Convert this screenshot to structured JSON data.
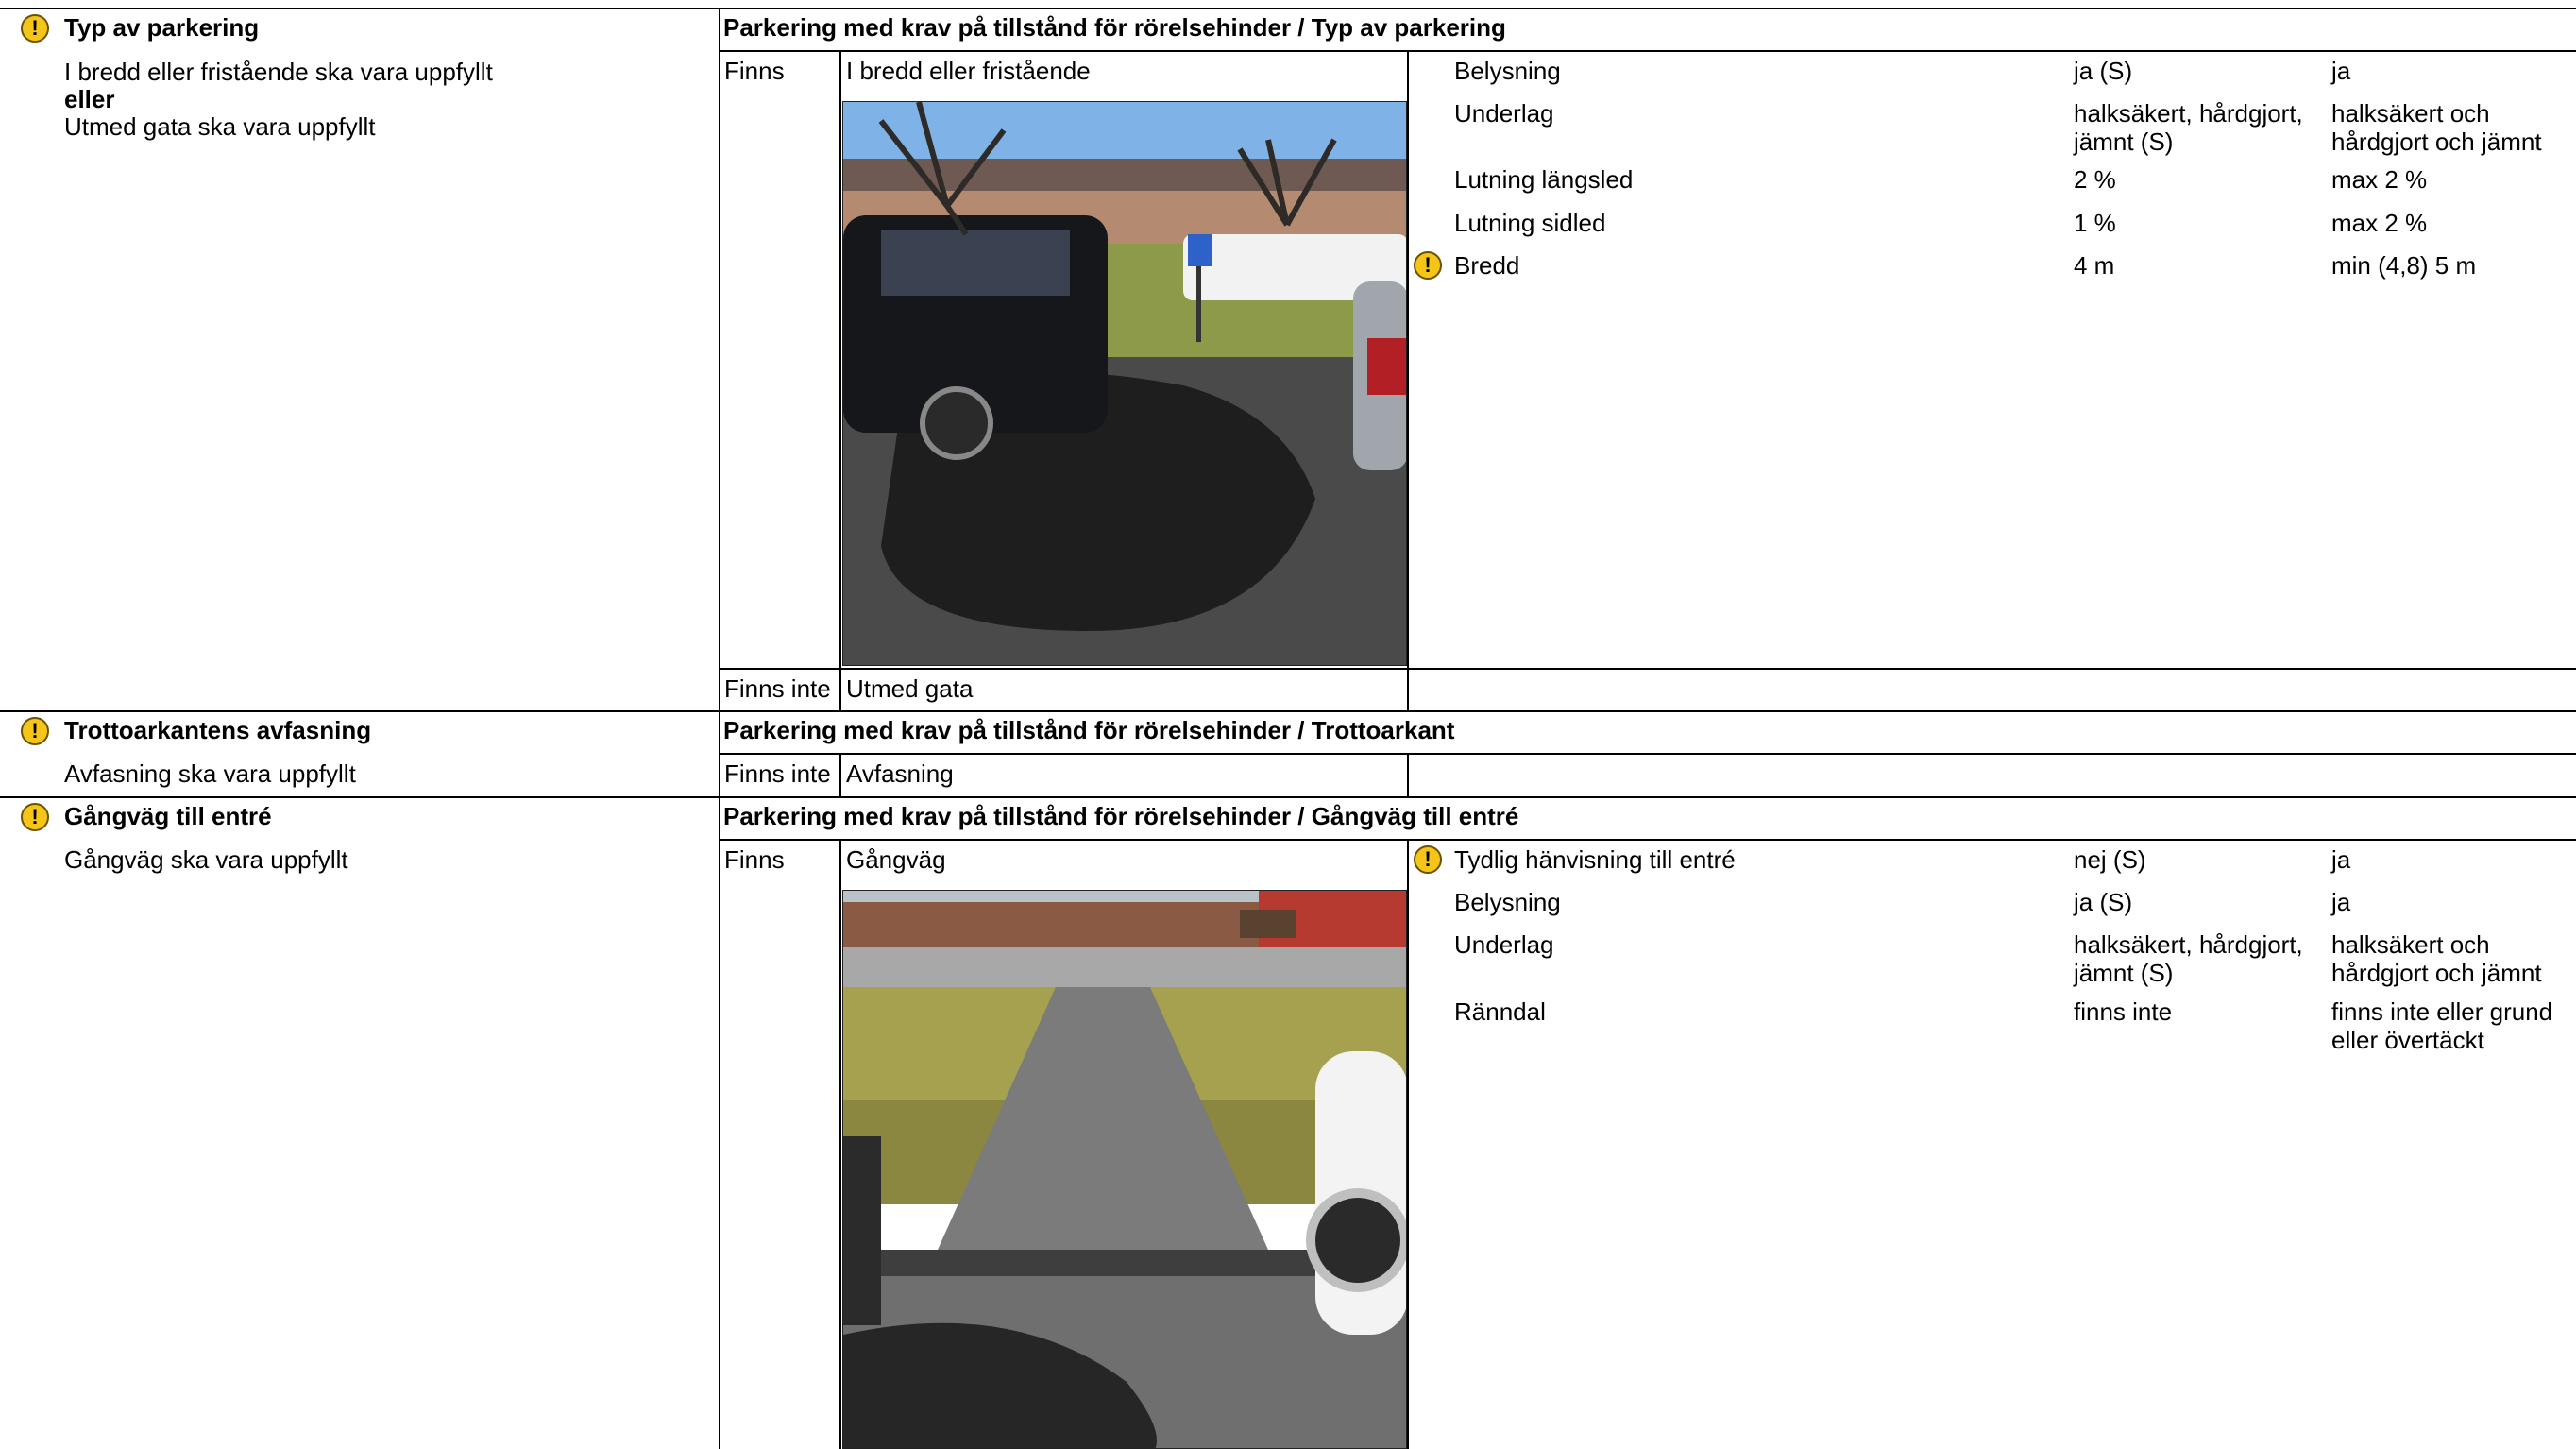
{
  "sections": [
    {
      "title": "Typ av parkering",
      "requirement_lines": [
        "I bredd eller fristående ska vara uppfyllt",
        "eller",
        "Utmed gata ska vara uppfyllt"
      ],
      "header": "Parkering med krav på tillstånd för rörelsehinder / Typ av parkering",
      "options": [
        {
          "status": "Finns",
          "name": "I bredd eller fristående"
        },
        {
          "status": "Finns inte",
          "name": "Utmed gata"
        }
      ],
      "properties": [
        {
          "name": "Belysning",
          "value": "ja (S)",
          "req": "ja",
          "warning": false
        },
        {
          "name": "Underlag",
          "value": "halksäkert, hårdgjort, jämnt (S)",
          "req": "halksäkert och hårdgjort och jämnt",
          "warning": false
        },
        {
          "name": "Lutning längsled",
          "value": "2 %",
          "req": "max 2 %",
          "warning": false
        },
        {
          "name": "Lutning sidled",
          "value": "1 %",
          "req": "max 2 %",
          "warning": false
        },
        {
          "name": "Bredd",
          "value": "4 m",
          "req": "min (4,8) 5 m",
          "warning": true
        }
      ]
    },
    {
      "title": "Trottoarkantens avfasning",
      "requirement_lines": [
        "Avfasning ska vara uppfyllt"
      ],
      "header": "Parkering med krav på tillstånd för rörelsehinder / Trottoarkant",
      "options": [
        {
          "status": "Finns inte",
          "name": "Avfasning"
        }
      ]
    },
    {
      "title": "Gångväg till entré",
      "requirement_lines": [
        "Gångväg ska vara uppfyllt"
      ],
      "header": "Parkering med krav på tillstånd för rörelsehinder / Gångväg till entré",
      "options": [
        {
          "status": "Finns",
          "name": "Gångväg"
        }
      ],
      "properties": [
        {
          "name": "Tydlig hänvisning till entré",
          "value": "nej (S)",
          "req": "ja",
          "warning": true
        },
        {
          "name": "Belysning",
          "value": "ja (S)",
          "req": "ja",
          "warning": false
        },
        {
          "name": "Underlag",
          "value": "halksäkert, hårdgjort, jämnt (S)",
          "req": "halksäkert och hårdgjort och jämnt",
          "warning": false
        },
        {
          "name": "Ränndal",
          "value": "finns inte",
          "req": "finns inte eller grund eller övertäckt",
          "warning": false
        }
      ]
    }
  ],
  "icons": {
    "warning": "warning-exclamation-icon",
    "warning_glyph": "!"
  },
  "colors": {
    "warning_fill": "#f5c518",
    "rule": "#000000"
  }
}
